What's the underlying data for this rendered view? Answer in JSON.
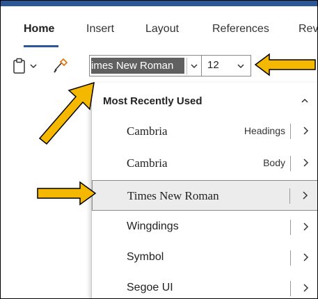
{
  "tabs": [
    {
      "label": "Home",
      "active": true
    },
    {
      "label": "Insert",
      "active": false
    },
    {
      "label": "Layout",
      "active": false
    },
    {
      "label": "References",
      "active": false
    },
    {
      "label": "Rev",
      "active": false
    }
  ],
  "toolbar": {
    "paste_icon": "clipboard-icon",
    "paste_dropdown_icon": "chevron-down-icon",
    "format_painter_icon": "format-painter-icon",
    "font_name": "imes New Roman",
    "font_size": "12"
  },
  "font_dropdown": {
    "section_title": "Most Recently Used",
    "items": [
      {
        "name": "Cambria",
        "tag": "Headings",
        "serif": true,
        "selected": false
      },
      {
        "name": "Cambria",
        "tag": "Body",
        "serif": true,
        "selected": false
      },
      {
        "name": "Times New Roman",
        "tag": "",
        "serif": true,
        "selected": true
      },
      {
        "name": "Wingdings",
        "tag": "",
        "serif": false,
        "selected": false
      },
      {
        "name": "Symbol",
        "tag": "",
        "serif": false,
        "selected": false
      },
      {
        "name": "Segoe UI",
        "tag": "",
        "serif": false,
        "selected": false
      }
    ]
  },
  "colors": {
    "accent": "#2b579a",
    "callout_fill": "#f5b800",
    "callout_stroke": "#000000",
    "selected_text_bg": "#606060"
  }
}
